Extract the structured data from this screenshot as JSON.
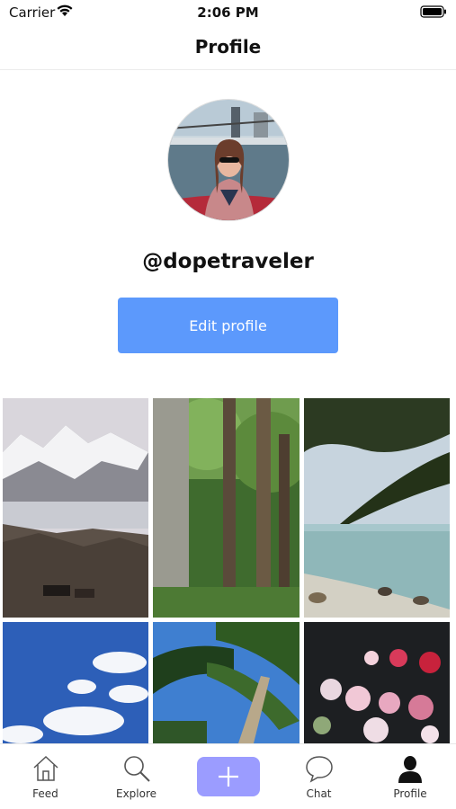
{
  "status_bar": {
    "carrier": "Carrier",
    "time": "2:06 PM"
  },
  "header": {
    "title": "Profile"
  },
  "profile": {
    "username": "@dopetraveler",
    "edit_label": "Edit profile"
  },
  "photos": [
    {
      "subject": "snowy mountains with horses"
    },
    {
      "subject": "forest tree trunks"
    },
    {
      "subject": "palm leaves over beach"
    },
    {
      "subject": "blue sky with clouds"
    },
    {
      "subject": "palm tree looking up"
    },
    {
      "subject": "flowers underwater"
    }
  ],
  "tab_bar": {
    "items": [
      {
        "label": "Feed",
        "icon": "home-icon"
      },
      {
        "label": "Explore",
        "icon": "search-icon"
      },
      {
        "label": "",
        "icon": "plus-icon"
      },
      {
        "label": "Chat",
        "icon": "chat-bubble-icon"
      },
      {
        "label": "Profile",
        "icon": "person-icon",
        "active": true
      }
    ]
  },
  "colors": {
    "accent": "#5c99fc",
    "add_button": "#9b9cff"
  }
}
